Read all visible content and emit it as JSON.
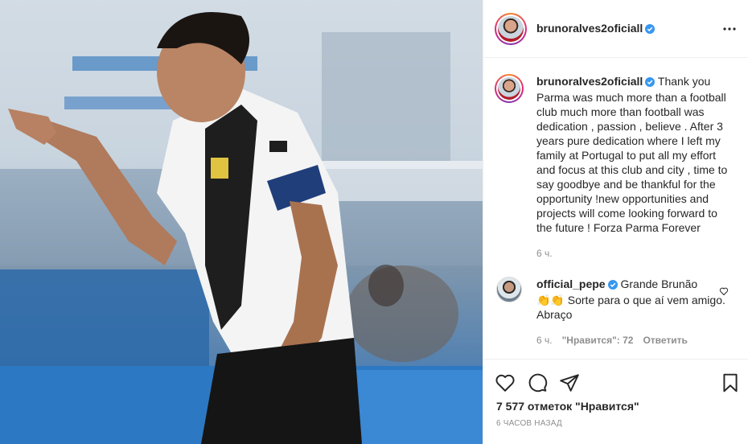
{
  "post": {
    "author": "brunoralves2oficiall",
    "verified": true
  },
  "caption": {
    "author": "brunoralves2oficiall",
    "text": "Thank you Parma was much more than a football club much more than football was dedication , passion , believe . After 3 years pure dedication where I left my family at Portugal to put all my effort and focus at this club and city , time to say goodbye and be thankful for the opportunity !new opportunities and projects will come looking forward to the future ! Forza Parma Forever",
    "time": "6 ч."
  },
  "comment": {
    "author": "official_pepe",
    "text_line1": "Grande Brunão",
    "text_line2": "Sorte para o que aí vem amigo. Abraço",
    "emoji": "👏👏",
    "time": "6 ч.",
    "likes": "\"Нравится\": 72",
    "reply_label": "Ответить"
  },
  "footer": {
    "likes": "7 577 отметок \"Нравится\"",
    "posted": "6 ЧАСОВ НАЗАД"
  },
  "icons": {
    "more": "more-options-icon",
    "like": "heart-icon",
    "comment": "comment-icon",
    "share": "share-icon",
    "save": "bookmark-icon",
    "verified": "verified-badge-icon"
  },
  "colors": {
    "verified": "#3897f0",
    "text": "#262626",
    "muted": "#8e8e8e",
    "divider": "#efefef"
  }
}
